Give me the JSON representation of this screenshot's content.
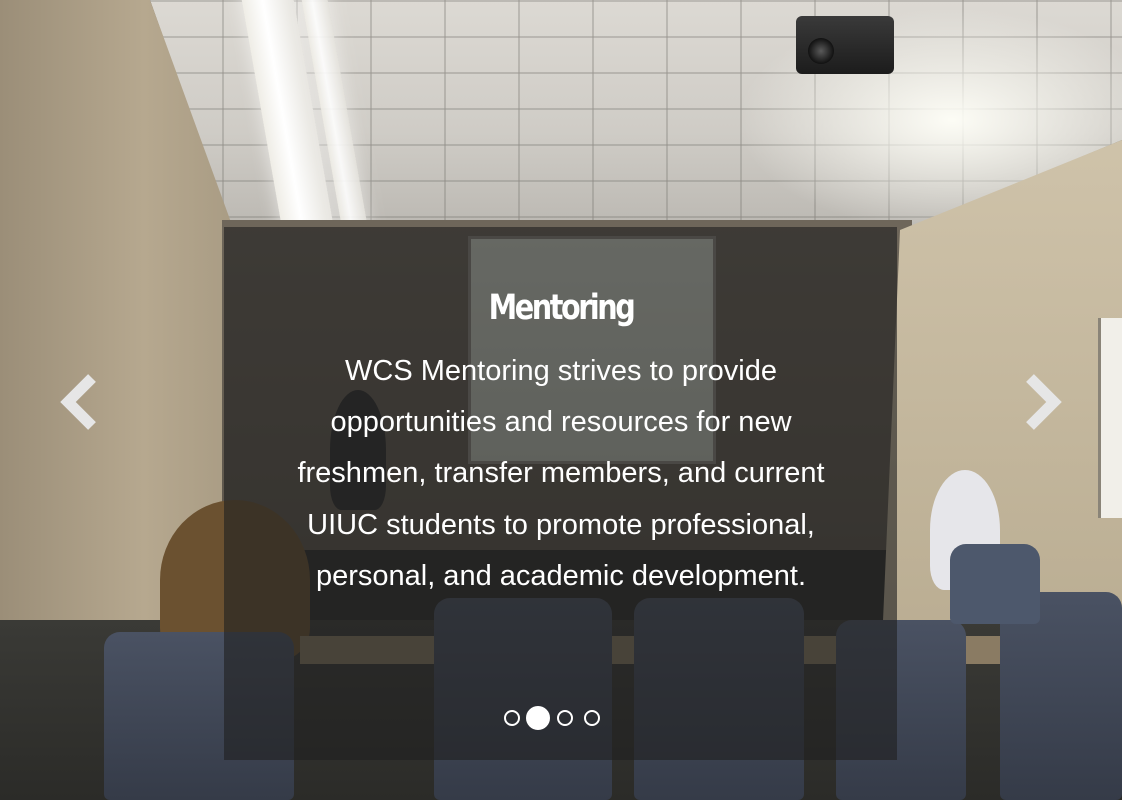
{
  "carousel": {
    "active_index": 1,
    "slide": {
      "title": "Mentoring",
      "body": "WCS Mentoring strives to provide opportunities and resources for new freshmen, transfer members, and current UIUC students to promote professional, personal, and academic development."
    },
    "controls": {
      "prev_icon": "chevron-left-icon",
      "next_icon": "chevron-right-icon"
    },
    "indicators": [
      {
        "active": false
      },
      {
        "active": true
      },
      {
        "active": false
      },
      {
        "active": false
      }
    ]
  },
  "colors": {
    "caption_overlay": "#202020",
    "text": "#ffffff",
    "arrow": "#e8e8e8"
  }
}
